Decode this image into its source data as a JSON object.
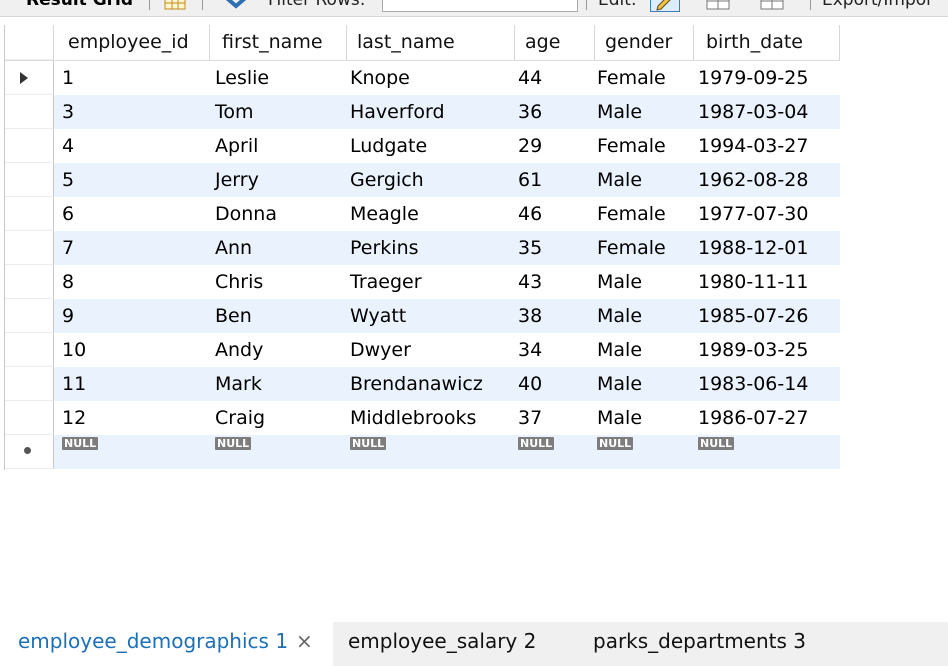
{
  "toolbar": {
    "result_grid_label": "Result Grid",
    "filter_rows_label": "Filter Rows:",
    "filter_value": "",
    "edit_label": "Edit:",
    "export_label": "Export/Impor"
  },
  "grid": {
    "columns": [
      "employee_id",
      "first_name",
      "last_name",
      "age",
      "gender",
      "birth_date"
    ],
    "rows": [
      [
        "1",
        "Leslie",
        "Knope",
        "44",
        "Female",
        "1979-09-25"
      ],
      [
        "3",
        "Tom",
        "Haverford",
        "36",
        "Male",
        "1987-03-04"
      ],
      [
        "4",
        "April",
        "Ludgate",
        "29",
        "Female",
        "1994-03-27"
      ],
      [
        "5",
        "Jerry",
        "Gergich",
        "61",
        "Male",
        "1962-08-28"
      ],
      [
        "6",
        "Donna",
        "Meagle",
        "46",
        "Female",
        "1977-07-30"
      ],
      [
        "7",
        "Ann",
        "Perkins",
        "35",
        "Female",
        "1988-12-01"
      ],
      [
        "8",
        "Chris",
        "Traeger",
        "43",
        "Male",
        "1980-11-11"
      ],
      [
        "9",
        "Ben",
        "Wyatt",
        "38",
        "Male",
        "1985-07-26"
      ],
      [
        "10",
        "Andy",
        "Dwyer",
        "34",
        "Male",
        "1989-03-25"
      ],
      [
        "11",
        "Mark",
        "Brendanawicz",
        "40",
        "Male",
        "1983-06-14"
      ],
      [
        "12",
        "Craig",
        "Middlebrooks",
        "37",
        "Male",
        "1986-07-27"
      ]
    ],
    "null_label": "NULL"
  },
  "tabs": [
    {
      "label": "employee_demographics 1",
      "active": true,
      "close": "×"
    },
    {
      "label": "employee_salary 2",
      "active": false
    },
    {
      "label": "parks_departments 3",
      "active": false
    }
  ],
  "colors": {
    "alt_row": "#eaf2fd",
    "active_tab_text": "#1d6fb8",
    "null_badge": "#7d7d7d"
  }
}
